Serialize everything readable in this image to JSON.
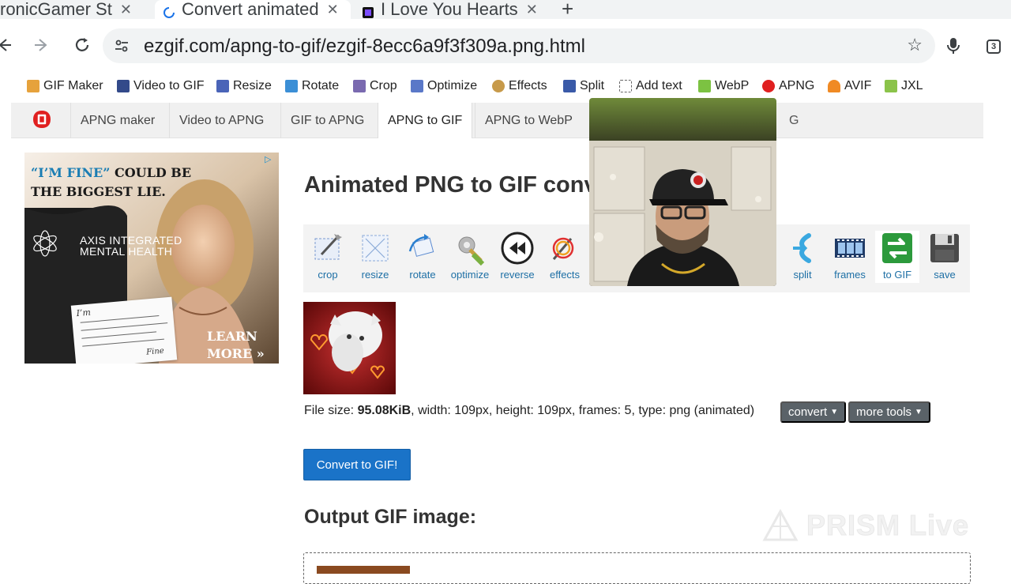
{
  "browser": {
    "tabs": [
      {
        "title": "ronicGamer St",
        "active": false
      },
      {
        "title": "Convert animated",
        "active": true
      },
      {
        "title": "I Love You Hearts",
        "active": false
      }
    ],
    "new_tab": "+",
    "url": "ezgif.com/apng-to-gif/ezgif-8ecc6a9f3f309a.png.html",
    "tab_count": "3"
  },
  "site_nav": [
    {
      "label": "GIF Maker",
      "icon": "gif-maker-icon",
      "color": "#e6a23c"
    },
    {
      "label": "Video to GIF",
      "icon": "film-icon",
      "color": "#334a8a"
    },
    {
      "label": "Resize",
      "icon": "resize-icon",
      "color": "#4a64b8"
    },
    {
      "label": "Rotate",
      "icon": "rotate-icon",
      "color": "#3b8fd6"
    },
    {
      "label": "Crop",
      "icon": "crop-icon",
      "color": "#7a6ab0"
    },
    {
      "label": "Optimize",
      "icon": "optimize-icon",
      "color": "#5a78c8"
    },
    {
      "label": "Effects",
      "icon": "palette-icon",
      "color": "#c79a4a"
    },
    {
      "label": "Split",
      "icon": "split-icon",
      "color": "#3a5aa8"
    },
    {
      "label": "Add text",
      "icon": "text-icon",
      "color": "#666666"
    },
    {
      "label": "WebP",
      "icon": "webp-icon",
      "color": "#7cc242"
    },
    {
      "label": "APNG",
      "icon": "apng-icon",
      "color": "#e02020"
    },
    {
      "label": "AVIF",
      "icon": "avif-icon",
      "color": "#f08a24"
    },
    {
      "label": "JXL",
      "icon": "jxl-icon",
      "color": "#8bc34a"
    }
  ],
  "subnav": {
    "tabs": [
      "APNG maker",
      "Video to APNG",
      "GIF to APNG",
      "APNG to GIF",
      "APNG to WebP"
    ],
    "active": "APNG to GIF",
    "trailing": "G"
  },
  "ad": {
    "headline_quote": "“I’M FINE”",
    "headline_rest": " COULD BE THE BIGGEST LIE.",
    "brand_line1": "AXIS INTEGRATED",
    "brand_line2": "MENTAL HEALTH",
    "cta_line1": "LEARN",
    "cta_line2": "MORE »",
    "note_top": "I’m",
    "note_bottom": "Fine"
  },
  "main": {
    "title": "Animated PNG to GIF conv",
    "tools": [
      {
        "label": "crop",
        "icon": "crop-tool-icon"
      },
      {
        "label": "resize",
        "icon": "resize-tool-icon"
      },
      {
        "label": "rotate",
        "icon": "rotate-tool-icon"
      },
      {
        "label": "optimize",
        "icon": "optimize-tool-icon"
      },
      {
        "label": "reverse",
        "icon": "reverse-tool-icon"
      },
      {
        "label": "effects",
        "icon": "effects-tool-icon"
      },
      {
        "label": "split",
        "icon": "split-tool-icon"
      },
      {
        "label": "frames",
        "icon": "frames-tool-icon"
      },
      {
        "label": "to GIF",
        "icon": "to-gif-tool-icon"
      },
      {
        "label": "save",
        "icon": "save-tool-icon"
      }
    ],
    "file_info_prefix": "File size: ",
    "file_size": "95.08KiB",
    "file_info_rest": ", width: 109px, height: 109px, frames: 5, type: png (animated)",
    "convert_dropdown": "convert",
    "more_tools_dropdown": "more tools",
    "convert_button": "Convert to GIF!",
    "output_heading": "Output GIF image:"
  },
  "watermark": "PRISM Live",
  "colors": {
    "primary_button": "#1a73c8",
    "dropdown_button": "#5a6268",
    "tool_label": "#1d6fa5"
  }
}
